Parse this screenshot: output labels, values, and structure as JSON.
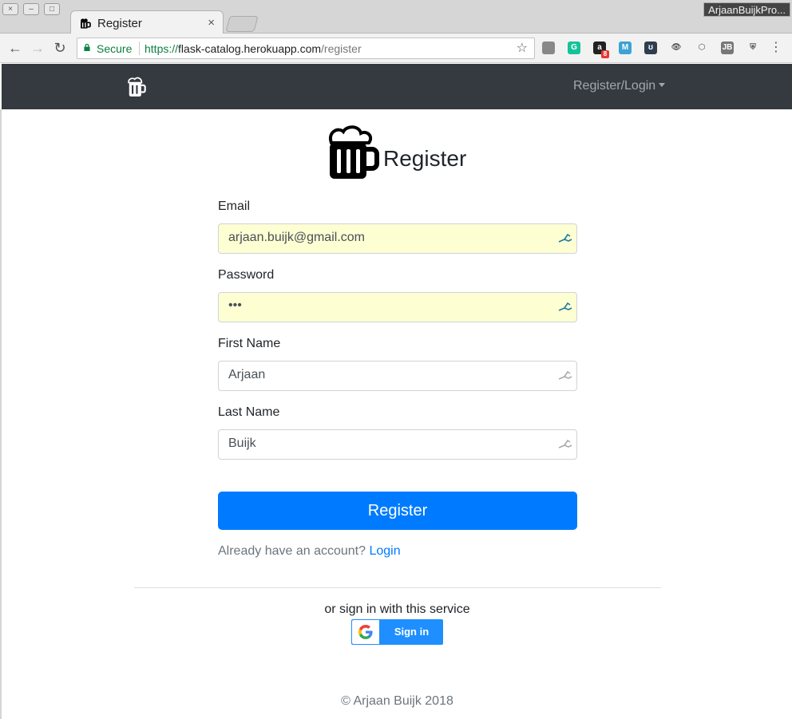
{
  "browser": {
    "tab_title": "Register",
    "tab_close": "×",
    "profile_name": "ArjaanBuijkPro...",
    "secure_label": "Secure",
    "url_scheme": "https://",
    "url_host": "flask-catalog.herokuapp.com",
    "url_path": "/register",
    "window_buttons": {
      "close": "×",
      "minimize": "–",
      "maximize": "□"
    },
    "extensions": [
      {
        "name": "pocket-extension-icon",
        "color": "#888888",
        "glyph": ""
      },
      {
        "name": "grammarly-extension-icon",
        "color": "#15c39a",
        "glyph": "G"
      },
      {
        "name": "amazon-assistant-extension-icon",
        "color": "#222222",
        "glyph": "a",
        "badge": "8"
      },
      {
        "name": "m-extension-icon",
        "color": "#3ca3d4",
        "glyph": "M"
      },
      {
        "name": "u-extension-icon",
        "color": "#2f3e4e",
        "glyph": "ʊ"
      },
      {
        "name": "eye-extension-icon",
        "color": "#f2f2f2",
        "glyph": "👁"
      },
      {
        "name": "cube-extension-icon",
        "color": "#f2f2f2",
        "glyph": "⬡"
      },
      {
        "name": "jb-extension-icon",
        "color": "#777777",
        "glyph": "JB"
      },
      {
        "name": "shield-extension-icon",
        "color": "#f2f2f2",
        "glyph": "⛨"
      }
    ]
  },
  "navbar": {
    "menu_label": "Register/Login"
  },
  "form": {
    "title": "Register",
    "fields": {
      "email": {
        "label": "Email",
        "value": "arjaan.buijk@gmail.com"
      },
      "password": {
        "label": "Password",
        "value": "•••"
      },
      "first_name": {
        "label": "First Name",
        "value": "Arjaan"
      },
      "last_name": {
        "label": "Last Name",
        "value": "Buijk"
      }
    },
    "submit_label": "Register",
    "already_text": "Already have an account?",
    "login_link": "Login"
  },
  "social": {
    "prompt": "or sign in with this service",
    "google_label": "Sign in"
  },
  "footer": {
    "text": "© Arjaan Buijk 2018"
  },
  "colors": {
    "navbar_bg": "#343a40",
    "primary": "#007bff",
    "autofill_bg": "#fefed3"
  }
}
